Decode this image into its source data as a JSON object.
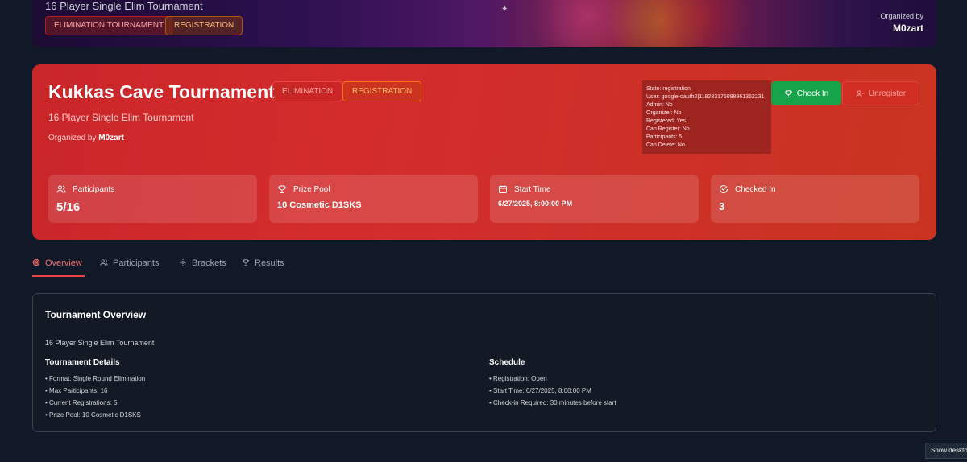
{
  "banner": {
    "subtitle": "16 Player Single Elim Tournament",
    "tags": [
      "ELIMINATION TOURNAMENT",
      "REGISTRATION"
    ],
    "organized_by_label": "Organized by",
    "organizer": "M0zart"
  },
  "hero": {
    "title": "Kukkas Cave Tournament",
    "badges": [
      "ELIMINATION",
      "REGISTRATION"
    ],
    "subtitle": "16 Player Single Elim Tournament",
    "organized_by_label": "Organized by",
    "organizer": "M0zart",
    "debug": [
      "State: registration",
      "User: google-oauth2|118233175088961362231",
      "Admin: No",
      "Organizer: No",
      "Registered: Yes",
      "Can Register: No",
      "Participants: 5",
      "Can Delete: No"
    ],
    "check_in_label": "Check In",
    "unregister_label": "Unregister",
    "stats": [
      {
        "label": "Participants",
        "value": "5/16",
        "icon": "users-icon"
      },
      {
        "label": "Prize Pool",
        "value": "10 Cosmetic D1SKS",
        "icon": "trophy-icon"
      },
      {
        "label": "Start Time",
        "value": "6/27/2025, 8:00:00 PM",
        "icon": "calendar-icon"
      },
      {
        "label": "Checked In",
        "value": "3",
        "icon": "check-circle-icon"
      }
    ]
  },
  "tabs": [
    {
      "label": "Overview",
      "icon": "target-icon",
      "active": true
    },
    {
      "label": "Participants",
      "icon": "users-icon",
      "active": false
    },
    {
      "label": "Brackets",
      "icon": "gear-icon",
      "active": false
    },
    {
      "label": "Results",
      "icon": "trophy-icon",
      "active": false
    }
  ],
  "overview": {
    "title": "Tournament Overview",
    "description": "16 Player Single Elim Tournament",
    "details_heading": "Tournament Details",
    "details": [
      "• Format: Single Round Elimination",
      "• Max Participants: 16",
      "• Current Registrations: 5",
      "• Prize Pool: 10 Cosmetic D1SKS"
    ],
    "schedule_heading": "Schedule",
    "schedule": [
      "• Registration: Open",
      "• Start Time: 6/27/2025, 8:00:00 PM",
      "• Check-in Required: 30 minutes before start"
    ]
  },
  "tooltip": "Show desktop",
  "colors": {
    "hero_red": "#d42c2c",
    "check_in_green": "#16a34a",
    "active_tab": "#ef4444",
    "page_bg": "#111827"
  }
}
